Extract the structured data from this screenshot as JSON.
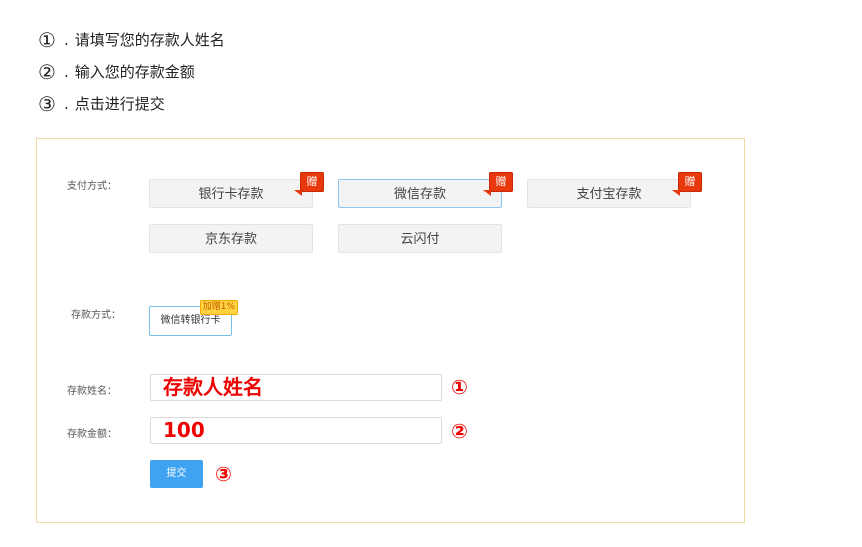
{
  "instructions": [
    {
      "num": "①",
      "dot": ".",
      "text": "请填写您的存款人姓名"
    },
    {
      "num": "②",
      "dot": ".",
      "text": "输入您的存款金额"
    },
    {
      "num": "③",
      "dot": ".",
      "text": "点击进行提交"
    }
  ],
  "form": {
    "payment_label": "支付方式：",
    "payment_options": [
      {
        "label": "银行卡存款",
        "badge": "赠"
      },
      {
        "label": "微信存款",
        "badge": "赠"
      },
      {
        "label": "支付宝存款",
        "badge": "赠"
      },
      {
        "label": "京东存款"
      },
      {
        "label": "云闪付"
      }
    ],
    "method_label": "存款方式：",
    "method_option": {
      "label": "微信转银行卡",
      "badge": "加赠1%"
    },
    "name_label": "存款姓名：",
    "name_value": "存款人姓名",
    "amount_label": "存款金额：",
    "amount_value": "100",
    "submit_label": "提交",
    "markers": [
      "①",
      "②",
      "③"
    ]
  },
  "colors": {
    "accent": "#3fa3f1",
    "highlight_red": "#e00000",
    "panel_border": "#f0d9a6",
    "gift_badge": "#e8380d"
  }
}
